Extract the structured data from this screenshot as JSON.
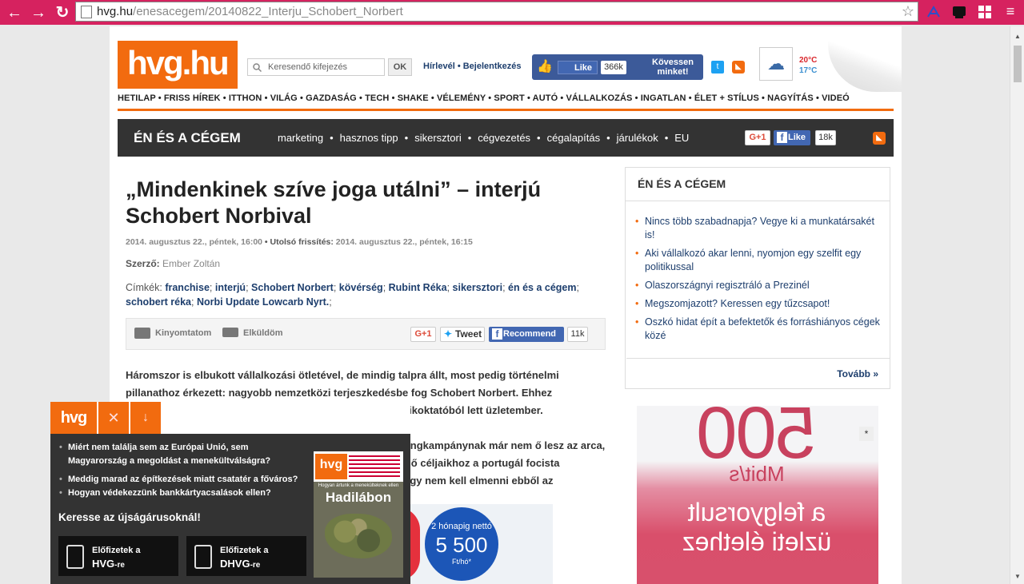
{
  "browser": {
    "url_domain": "hvg.hu",
    "url_path": "/enesacegem/20140822_Interju_Schobert_Norbert",
    "accent": "#d6225f"
  },
  "header": {
    "logo": "hvg.hu",
    "search_placeholder": "Keresendő kifejezés",
    "ok_label": "OK",
    "newsletter": "Hírlevél",
    "login": "Bejelentkezés",
    "fb_like": "Like",
    "fb_count": "366k",
    "follow": "Kövessen minket!",
    "temp_high": "20°C",
    "temp_low": "17°C"
  },
  "mainnav": [
    "HETILAP",
    "FRISS HÍREK",
    "ITTHON",
    "VILÁG",
    "GAZDASÁG",
    "TECH",
    "SHAKE",
    "VÉLEMÉNY",
    "SPORT",
    "AUTÓ",
    "VÁLLALKOZÁS",
    "INGATLAN",
    "ÉLET + STÍLUS",
    "NAGYÍTÁS",
    "VIDEÓ"
  ],
  "section": {
    "title": "ÉN ÉS A CÉGEM",
    "links": [
      "marketing",
      "hasznos tipp",
      "sikersztori",
      "cégvezetés",
      "cégalapítás",
      "járulékok",
      "EU"
    ],
    "gplus": "G+1",
    "like": "Like",
    "like_count": "18k"
  },
  "article": {
    "title": "„Mindenkinek szíve joga utálni” – interjú Schobert Norbival",
    "date": "2014. augusztus 22., péntek, 16:00",
    "updated_label": "Utolsó frissítés:",
    "updated": "2014. augusztus 22., péntek, 16:15",
    "author_label": "Szerző:",
    "author": "Ember Zoltán",
    "tags_label": "Címkék:",
    "tags": [
      "franchise",
      "interjú",
      "Schobert Norbert",
      "kövérség",
      "Rubint Réka",
      "sikersztori",
      "én és a cégem",
      "schobert réka",
      "Norbi Update Lowcarb Nyrt."
    ],
    "print": "Kinyomtatom",
    "send": "Elküldöm",
    "gplus": "G+1",
    "tweet": "Tweet",
    "recommend": "Recommend",
    "recommend_count": "11k",
    "lead_lines": [
      "Háromszor is elbukott vállalkozási ötletével, de mindig talpra állt, most pedig történelmi",
      "pillanathoz érkezett: nagyobb nemzetközi terjeszkedésbe fog Schobert Norbert. Ehhez",
      "ell, így tőzsdére viszi a cégét az aerobikoktatóból lett üzletember. Magánvagyona",
      "lása szerint csekély. A külföldi marketingkampánynak már nem ő lesz az arca,",
      "a, az ő céljaikhoz a portugál focista",
      "a, hogy nem kell elmenni ebből az"
    ]
  },
  "inline_ad": {
    "line1": "2 hónapig nettó",
    "price": "5 500",
    "unit": "Ft/hó*"
  },
  "sidebar": {
    "title": "ÉN ÉS A CÉGEM",
    "items": [
      "Nincs több szabadnapja? Vegye ki a munkatársakét is!",
      "Aki vállalkozó akar lenni, nyomjon egy szelfit egy politikussal",
      "Olaszországnyi regisztráló a Prezinél",
      "Megszomjazott? Keressen egy tűzcsapot!",
      "Oszkó hidat épít a befektetők és forráshiányos cégek közé"
    ],
    "more": "Tovább »"
  },
  "side_ad": {
    "big": "500",
    "unit": "Mbit/s",
    "line1": "a felgyorsult",
    "line2": "üzleti élethez",
    "star": "*"
  },
  "popup": {
    "logo": "hvg",
    "close": "✕",
    "down": "↓",
    "items": [
      "Miért nem találja sem az Európai Unió, sem Magyarország a megoldást a menekültválságra?",
      "Meddig marad az építkezések miatt csatatér a főváros?",
      "Hogyan védekezzünk bankkártyacsalások ellen?"
    ],
    "call": "Keresse az újságárusoknál!",
    "sub1_line1": "Előfizetek a",
    "sub1_line2": "HVG",
    "sub2_line1": "Előfizetek a",
    "sub2_line2": "DHVG",
    "suffix": "-re",
    "cover_logo": "hvg",
    "cover_sub": "Hogyan ártunk a menekülteknek ellen",
    "cover_title": "Hadilábon"
  }
}
